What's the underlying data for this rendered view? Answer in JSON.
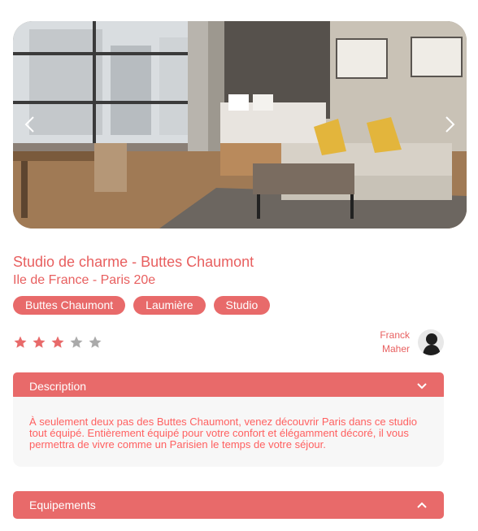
{
  "listing": {
    "title": "Studio de charme - Buttes Chaumont",
    "location": "Ile de France - Paris 20e",
    "tags": [
      "Buttes Chaumont",
      "Laumière",
      "Studio"
    ],
    "rating": 3,
    "rating_max": 5,
    "host": {
      "first_name": "Franck",
      "last_name": "Maher"
    }
  },
  "gallery": {
    "prev_icon": "chevron-left-icon",
    "next_icon": "chevron-right-icon"
  },
  "description": {
    "header": "Description",
    "text": "À seulement deux pas des Buttes Chaumont, venez découvrir Paris dans ce studio tout équipé. Entièrement équipé pour votre confort et élégamment décoré, il vous permettra de vivre comme un Parisien le temps de votre séjour.",
    "expanded": true
  },
  "equipment": {
    "header": "Equipements",
    "expanded": false
  },
  "colors": {
    "accent": "#e86a6a",
    "text": "#ff6060",
    "star_on": "#e86a6a",
    "star_off": "#aaaaaa"
  }
}
